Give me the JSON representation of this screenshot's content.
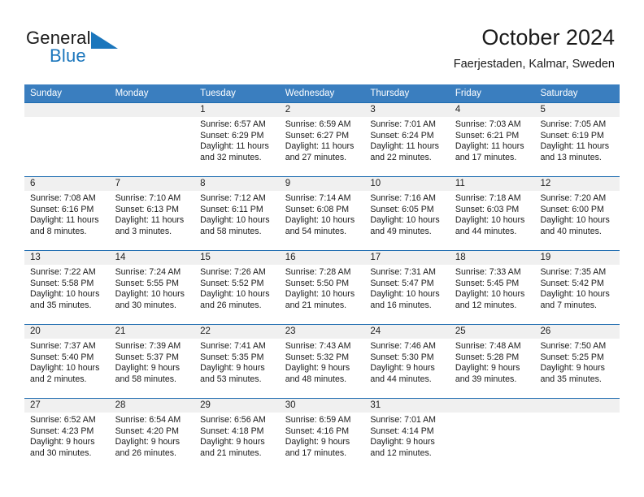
{
  "brand": {
    "name_part1": "General",
    "name_part2": "Blue",
    "logo_icon": "blue-triangle-logo"
  },
  "header": {
    "title": "October 2024",
    "location": "Faerjestaden, Kalmar, Sweden"
  },
  "colors": {
    "header_blue": "#3a7ebf",
    "row_rule_blue": "#1e6cb0",
    "daynum_band": "#f0f0f0",
    "brand_blue": "#1b76bc",
    "text": "#1a1a1a"
  },
  "calendar": {
    "weekdays": [
      "Sunday",
      "Monday",
      "Tuesday",
      "Wednesday",
      "Thursday",
      "Friday",
      "Saturday"
    ],
    "weeks": [
      [
        {
          "day": "",
          "sunrise": "",
          "sunset": "",
          "daylight1": "",
          "daylight2": ""
        },
        {
          "day": "",
          "sunrise": "",
          "sunset": "",
          "daylight1": "",
          "daylight2": ""
        },
        {
          "day": "1",
          "sunrise": "Sunrise: 6:57 AM",
          "sunset": "Sunset: 6:29 PM",
          "daylight1": "Daylight: 11 hours",
          "daylight2": "and 32 minutes."
        },
        {
          "day": "2",
          "sunrise": "Sunrise: 6:59 AM",
          "sunset": "Sunset: 6:27 PM",
          "daylight1": "Daylight: 11 hours",
          "daylight2": "and 27 minutes."
        },
        {
          "day": "3",
          "sunrise": "Sunrise: 7:01 AM",
          "sunset": "Sunset: 6:24 PM",
          "daylight1": "Daylight: 11 hours",
          "daylight2": "and 22 minutes."
        },
        {
          "day": "4",
          "sunrise": "Sunrise: 7:03 AM",
          "sunset": "Sunset: 6:21 PM",
          "daylight1": "Daylight: 11 hours",
          "daylight2": "and 17 minutes."
        },
        {
          "day": "5",
          "sunrise": "Sunrise: 7:05 AM",
          "sunset": "Sunset: 6:19 PM",
          "daylight1": "Daylight: 11 hours",
          "daylight2": "and 13 minutes."
        }
      ],
      [
        {
          "day": "6",
          "sunrise": "Sunrise: 7:08 AM",
          "sunset": "Sunset: 6:16 PM",
          "daylight1": "Daylight: 11 hours",
          "daylight2": "and 8 minutes."
        },
        {
          "day": "7",
          "sunrise": "Sunrise: 7:10 AM",
          "sunset": "Sunset: 6:13 PM",
          "daylight1": "Daylight: 11 hours",
          "daylight2": "and 3 minutes."
        },
        {
          "day": "8",
          "sunrise": "Sunrise: 7:12 AM",
          "sunset": "Sunset: 6:11 PM",
          "daylight1": "Daylight: 10 hours",
          "daylight2": "and 58 minutes."
        },
        {
          "day": "9",
          "sunrise": "Sunrise: 7:14 AM",
          "sunset": "Sunset: 6:08 PM",
          "daylight1": "Daylight: 10 hours",
          "daylight2": "and 54 minutes."
        },
        {
          "day": "10",
          "sunrise": "Sunrise: 7:16 AM",
          "sunset": "Sunset: 6:05 PM",
          "daylight1": "Daylight: 10 hours",
          "daylight2": "and 49 minutes."
        },
        {
          "day": "11",
          "sunrise": "Sunrise: 7:18 AM",
          "sunset": "Sunset: 6:03 PM",
          "daylight1": "Daylight: 10 hours",
          "daylight2": "and 44 minutes."
        },
        {
          "day": "12",
          "sunrise": "Sunrise: 7:20 AM",
          "sunset": "Sunset: 6:00 PM",
          "daylight1": "Daylight: 10 hours",
          "daylight2": "and 40 minutes."
        }
      ],
      [
        {
          "day": "13",
          "sunrise": "Sunrise: 7:22 AM",
          "sunset": "Sunset: 5:58 PM",
          "daylight1": "Daylight: 10 hours",
          "daylight2": "and 35 minutes."
        },
        {
          "day": "14",
          "sunrise": "Sunrise: 7:24 AM",
          "sunset": "Sunset: 5:55 PM",
          "daylight1": "Daylight: 10 hours",
          "daylight2": "and 30 minutes."
        },
        {
          "day": "15",
          "sunrise": "Sunrise: 7:26 AM",
          "sunset": "Sunset: 5:52 PM",
          "daylight1": "Daylight: 10 hours",
          "daylight2": "and 26 minutes."
        },
        {
          "day": "16",
          "sunrise": "Sunrise: 7:28 AM",
          "sunset": "Sunset: 5:50 PM",
          "daylight1": "Daylight: 10 hours",
          "daylight2": "and 21 minutes."
        },
        {
          "day": "17",
          "sunrise": "Sunrise: 7:31 AM",
          "sunset": "Sunset: 5:47 PM",
          "daylight1": "Daylight: 10 hours",
          "daylight2": "and 16 minutes."
        },
        {
          "day": "18",
          "sunrise": "Sunrise: 7:33 AM",
          "sunset": "Sunset: 5:45 PM",
          "daylight1": "Daylight: 10 hours",
          "daylight2": "and 12 minutes."
        },
        {
          "day": "19",
          "sunrise": "Sunrise: 7:35 AM",
          "sunset": "Sunset: 5:42 PM",
          "daylight1": "Daylight: 10 hours",
          "daylight2": "and 7 minutes."
        }
      ],
      [
        {
          "day": "20",
          "sunrise": "Sunrise: 7:37 AM",
          "sunset": "Sunset: 5:40 PM",
          "daylight1": "Daylight: 10 hours",
          "daylight2": "and 2 minutes."
        },
        {
          "day": "21",
          "sunrise": "Sunrise: 7:39 AM",
          "sunset": "Sunset: 5:37 PM",
          "daylight1": "Daylight: 9 hours",
          "daylight2": "and 58 minutes."
        },
        {
          "day": "22",
          "sunrise": "Sunrise: 7:41 AM",
          "sunset": "Sunset: 5:35 PM",
          "daylight1": "Daylight: 9 hours",
          "daylight2": "and 53 minutes."
        },
        {
          "day": "23",
          "sunrise": "Sunrise: 7:43 AM",
          "sunset": "Sunset: 5:32 PM",
          "daylight1": "Daylight: 9 hours",
          "daylight2": "and 48 minutes."
        },
        {
          "day": "24",
          "sunrise": "Sunrise: 7:46 AM",
          "sunset": "Sunset: 5:30 PM",
          "daylight1": "Daylight: 9 hours",
          "daylight2": "and 44 minutes."
        },
        {
          "day": "25",
          "sunrise": "Sunrise: 7:48 AM",
          "sunset": "Sunset: 5:28 PM",
          "daylight1": "Daylight: 9 hours",
          "daylight2": "and 39 minutes."
        },
        {
          "day": "26",
          "sunrise": "Sunrise: 7:50 AM",
          "sunset": "Sunset: 5:25 PM",
          "daylight1": "Daylight: 9 hours",
          "daylight2": "and 35 minutes."
        }
      ],
      [
        {
          "day": "27",
          "sunrise": "Sunrise: 6:52 AM",
          "sunset": "Sunset: 4:23 PM",
          "daylight1": "Daylight: 9 hours",
          "daylight2": "and 30 minutes."
        },
        {
          "day": "28",
          "sunrise": "Sunrise: 6:54 AM",
          "sunset": "Sunset: 4:20 PM",
          "daylight1": "Daylight: 9 hours",
          "daylight2": "and 26 minutes."
        },
        {
          "day": "29",
          "sunrise": "Sunrise: 6:56 AM",
          "sunset": "Sunset: 4:18 PM",
          "daylight1": "Daylight: 9 hours",
          "daylight2": "and 21 minutes."
        },
        {
          "day": "30",
          "sunrise": "Sunrise: 6:59 AM",
          "sunset": "Sunset: 4:16 PM",
          "daylight1": "Daylight: 9 hours",
          "daylight2": "and 17 minutes."
        },
        {
          "day": "31",
          "sunrise": "Sunrise: 7:01 AM",
          "sunset": "Sunset: 4:14 PM",
          "daylight1": "Daylight: 9 hours",
          "daylight2": "and 12 minutes."
        },
        {
          "day": "",
          "sunrise": "",
          "sunset": "",
          "daylight1": "",
          "daylight2": ""
        },
        {
          "day": "",
          "sunrise": "",
          "sunset": "",
          "daylight1": "",
          "daylight2": ""
        }
      ]
    ]
  }
}
